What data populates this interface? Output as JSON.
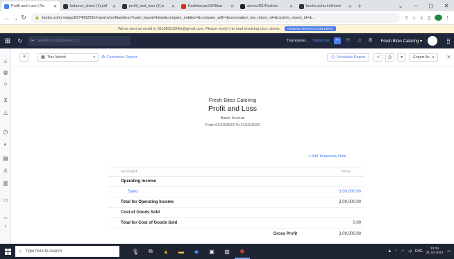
{
  "browser": {
    "tabs": [
      {
        "title": "Profit and Loss | Re",
        "color": "#4a7df0",
        "active": true
      },
      {
        "title": "balance_sheet (1).pdf",
        "color": "#333333",
        "active": false
      },
      {
        "title": "profit_and_loss (2).p",
        "color": "#333333",
        "active": false
      },
      {
        "title": "KarthikeyanS545kar",
        "color": "#d93025",
        "active": false
      },
      {
        "title": "ammu411/Fashion",
        "color": "#222222",
        "active": false
      },
      {
        "title": "books.zoho.in/Home",
        "color": "#333333",
        "active": false
      }
    ],
    "new_tab": "+",
    "url": "books.zoho.in/app/827405205#/reports/profitandloss?cash_based=false&compare_entities=&compare_with=&corporation_tax_return_id=&custom_report_id=&...",
    "profile_initial": "D"
  },
  "banner": {
    "text": "We've sent an email to 8110832190kk@gmail.com. Please verify it to start invoicing your clients.",
    "button": "RESEND VERIFICATION EMAIL"
  },
  "appbar": {
    "search_placeholder": "Search in Customers ( / )",
    "trial": "Trial expire...",
    "subscribe": "Subscribe",
    "org_name": "Fresh Bites Catering"
  },
  "toolbar": {
    "period": "This Month",
    "customize": "Customize Report",
    "schedule": "Schedule Report",
    "export": "Export As"
  },
  "report": {
    "org": "Fresh Bites Catering",
    "title": "Profit and Loss",
    "basis": "Basis: Accrual",
    "range": "From 01/10/2023 To 31/10/2023",
    "add_note": "+ Add Temporary Note",
    "col_account": "ACCOUNT",
    "col_total": "TOTAL",
    "rows": [
      {
        "label": "Operating Income",
        "amount": "",
        "type": "section"
      },
      {
        "label": "Sales",
        "amount": "3,00,000.00",
        "type": "indent"
      },
      {
        "label": "Total for Operating Income",
        "amount": "3,00,000.00",
        "type": "total"
      },
      {
        "label": "Cost of Goods Sold",
        "amount": "",
        "type": "section"
      },
      {
        "label": "Total for Cost of Goods Sold",
        "amount": "0.00",
        "type": "total"
      },
      {
        "label": "Gross Profit",
        "amount": "3,00,000.00",
        "type": "gross"
      }
    ]
  },
  "taskbar": {
    "search_placeholder": "Type here to search",
    "lang": "ENG",
    "time": "13:34",
    "date": "21-10-2023"
  }
}
